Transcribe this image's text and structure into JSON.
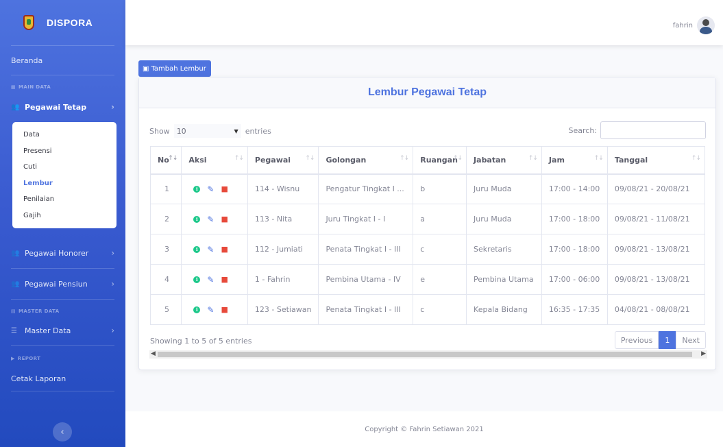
{
  "brand": {
    "name": "DISPORA"
  },
  "sidebar": {
    "beranda": "Beranda",
    "heading_main": "MAIN DATA",
    "pegawai_tetap": "Pegawai Tetap",
    "submenu": [
      "Data",
      "Presensi",
      "Cuti",
      "Lembur",
      "Penilaian",
      "Gajih"
    ],
    "pegawai_honorer": "Pegawai Honorer",
    "pegawai_pensiun": "Pegawai Pensiun",
    "heading_master": "MASTER DATA",
    "master_data": "Master Data",
    "heading_report": "REPORT",
    "cetak_laporan": "Cetak Laporan"
  },
  "topbar": {
    "username": "fahrin"
  },
  "actions": {
    "add_label": "Tambah Lembur"
  },
  "card": {
    "title": "Lembur Pegawai Tetap"
  },
  "table_controls": {
    "show": "Show",
    "entries_value": "10",
    "entries": "entries",
    "search": "Search:"
  },
  "table": {
    "headers": [
      "No",
      "Aksi",
      "Pegawai",
      "Golongan",
      "Ruangan",
      "Jabatan",
      "Jam",
      "Tanggal"
    ],
    "rows": [
      [
        "1",
        "114 - Wisnu",
        "Pengatur Tingkat I ...",
        "b",
        "Juru Muda",
        "17:00 - 14:00",
        "09/08/21 - 20/08/21"
      ],
      [
        "2",
        "113 - Nita",
        "Juru Tingkat I - I",
        "a",
        "Juru Muda",
        "17:00 - 18:00",
        "09/08/21 - 11/08/21"
      ],
      [
        "3",
        "112 - Jumiati",
        "Penata Tingkat I - III",
        "c",
        "Sekretaris",
        "17:00 - 18:00",
        "09/08/21 - 13/08/21"
      ],
      [
        "4",
        "1 - Fahrin",
        "Pembina Utama - IV",
        "e",
        "Pembina Utama",
        "17:00 - 06:00",
        "09/08/21 - 13/08/21"
      ],
      [
        "5",
        "123 - Setiawan",
        "Penata Tingkat I - III",
        "c",
        "Kepala Bidang",
        "16:35 - 17:35",
        "04/08/21 - 08/08/21"
      ]
    ]
  },
  "pagination": {
    "info": "Showing 1 to 5 of 5 entries",
    "previous": "Previous",
    "current": "1",
    "next": "Next"
  },
  "footer": {
    "copyright": "Copyright © Fahrin Setiawan 2021"
  }
}
